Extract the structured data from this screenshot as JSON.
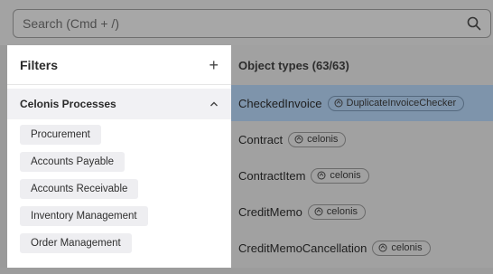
{
  "search": {
    "placeholder": "Search (Cmd + /)"
  },
  "filters": {
    "title": "Filters",
    "add_icon": "plus-icon",
    "group": {
      "title": "Celonis Processes",
      "expanded": true,
      "items": [
        {
          "label": "Procurement"
        },
        {
          "label": "Accounts Payable"
        },
        {
          "label": "Accounts Receivable"
        },
        {
          "label": "Inventory Management"
        },
        {
          "label": "Order Management"
        }
      ]
    }
  },
  "objects": {
    "header": "Object types (63/63)",
    "rows": [
      {
        "name": "CheckedInvoice",
        "tag": "DuplicateInvoiceChecker",
        "selected": true
      },
      {
        "name": "Contract",
        "tag": "celonis",
        "selected": false
      },
      {
        "name": "ContractItem",
        "tag": "celonis",
        "selected": false
      },
      {
        "name": "CreditMemo",
        "tag": "celonis",
        "selected": false
      },
      {
        "name": "CreditMemoCancellation",
        "tag": "celonis",
        "selected": false
      }
    ]
  },
  "colors": {
    "overlay": "#9a9a9a",
    "selected_row": "#7e94ab",
    "panel": "#ffffff",
    "chip": "#eeeef1"
  }
}
